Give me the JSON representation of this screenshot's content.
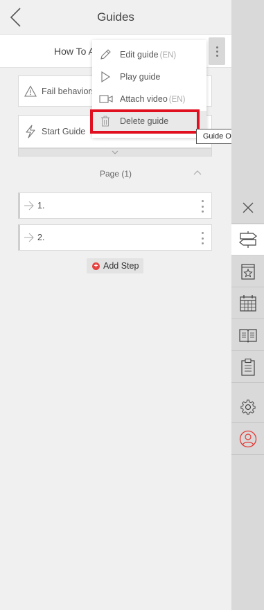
{
  "header": {
    "title": "Guides"
  },
  "guide": {
    "name": "How To A"
  },
  "cards": {
    "fail_label": "Fail behaviors",
    "start_label": "Start Guide"
  },
  "page": {
    "label": "Page (1)"
  },
  "steps": [
    {
      "label": "1."
    },
    {
      "label": "2."
    }
  ],
  "add_step_label": "Add Step",
  "menu": {
    "edit_label": "Edit guide",
    "edit_tag": "(EN)",
    "play_label": "Play guide",
    "video_label": "Attach video",
    "video_tag": "(EN)",
    "delete_label": "Delete guide"
  },
  "tooltip": "Guide Options",
  "colors": {
    "accent_red": "#e01020",
    "add_plus": "#e64040",
    "user_icon": "#e53935"
  },
  "sidebar_icons": [
    "close-icon",
    "signpost-icon",
    "favorites-icon",
    "calendar-icon",
    "book-icon",
    "clipboard-icon",
    "gear-icon",
    "user-icon"
  ]
}
